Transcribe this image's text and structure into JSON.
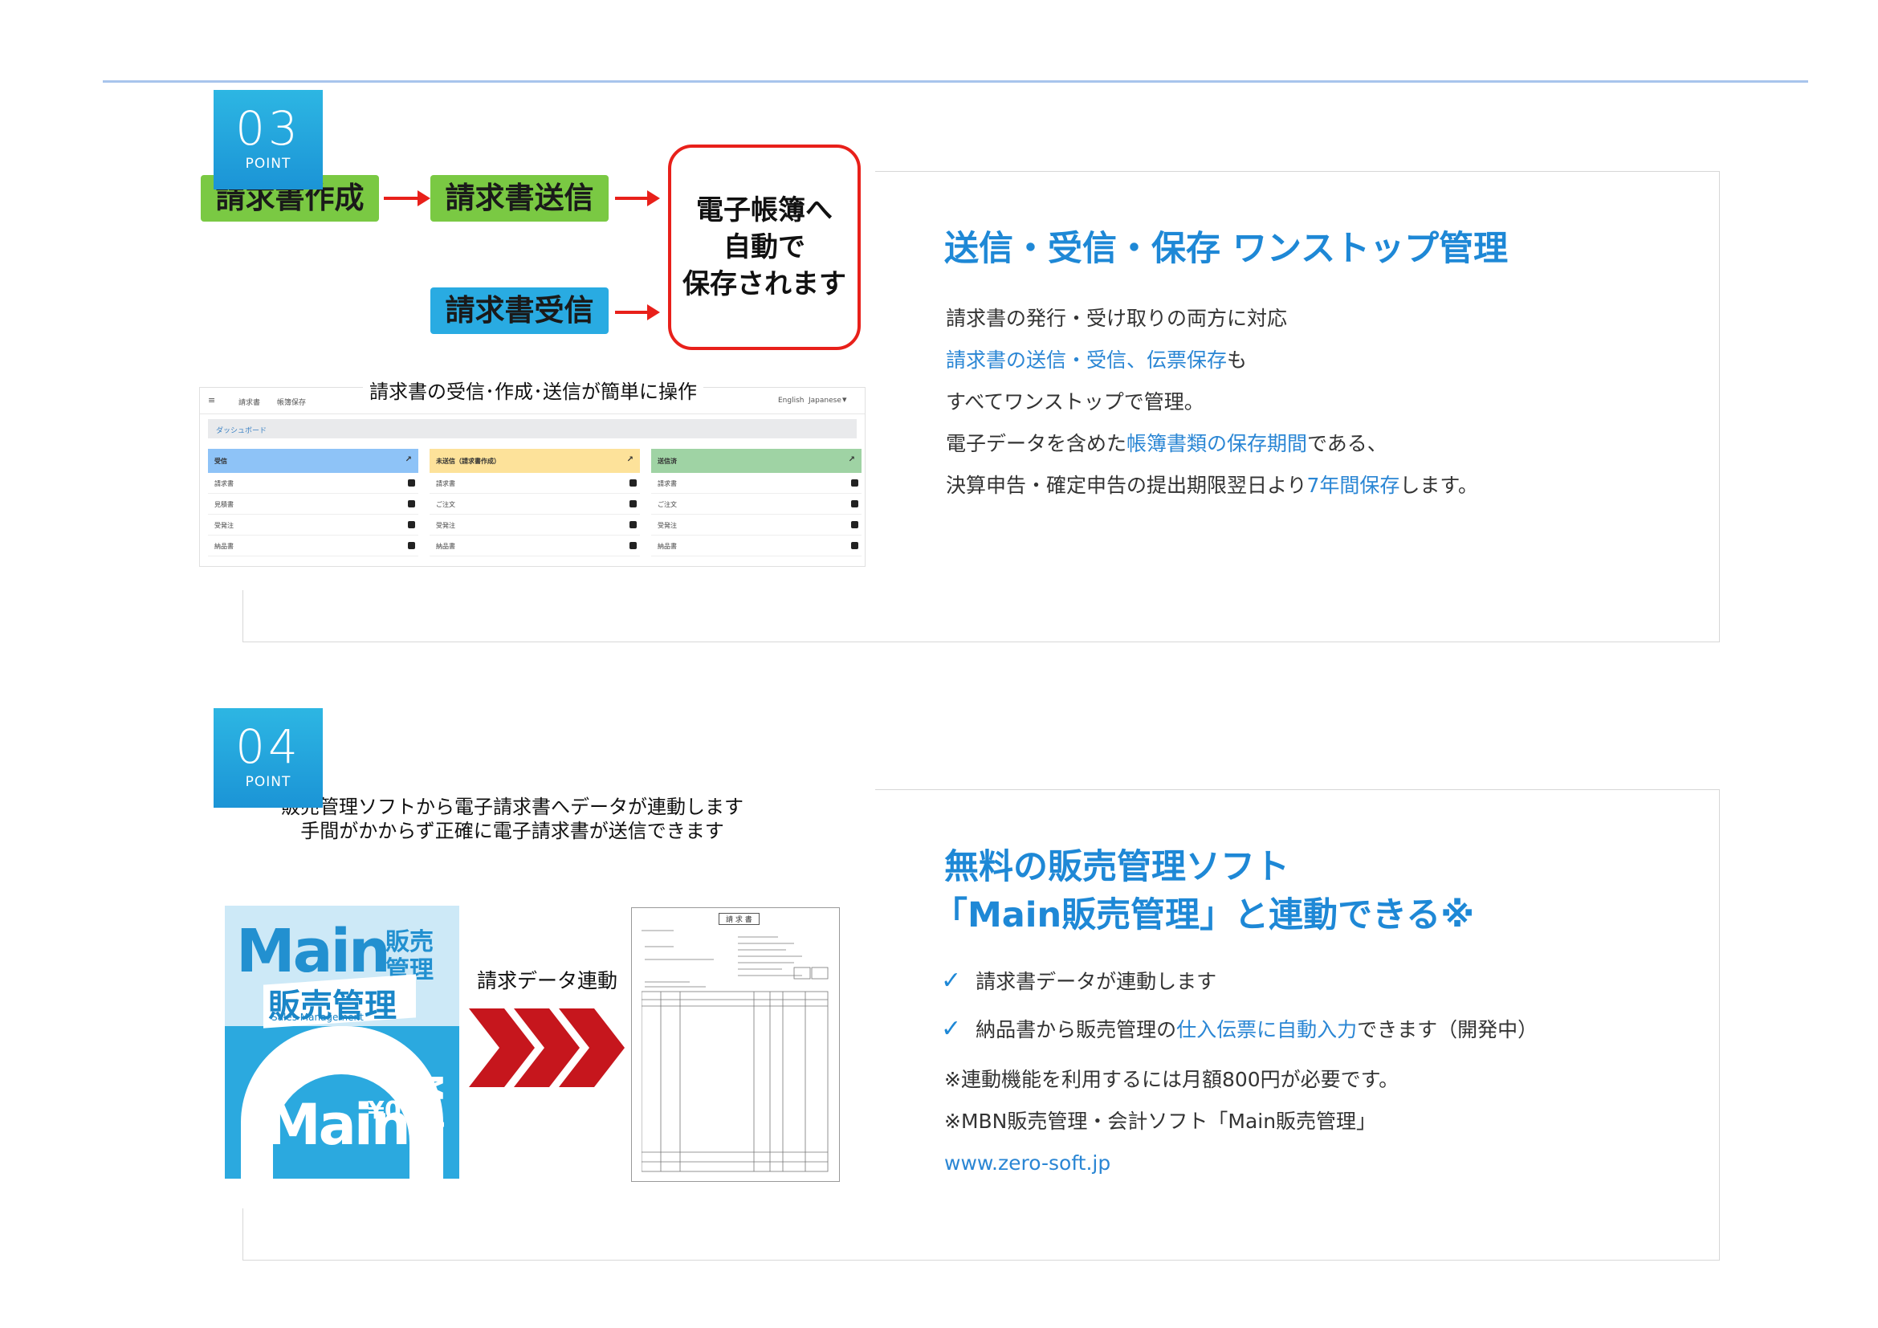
{
  "section3": {
    "badge_num": "03",
    "badge_label": "POINT",
    "flow": {
      "create": "請求書作成",
      "send": "請求書送信",
      "receive": "請求書受信",
      "save_line1": "電子帳簿へ",
      "save_line2": "自動で",
      "save_line3": "保存されます"
    },
    "screenshot_caption": "請求書の受信･作成･送信が簡単に操作",
    "dashboard": {
      "nav_items": [
        "請求書",
        "帳簿保存"
      ],
      "lang_en": "English",
      "lang_ja": "Japanese",
      "breadcrumb": "ダッシュボード",
      "columns": [
        {
          "title": "受信",
          "color": "#8ec3f7",
          "rows": [
            "請求書",
            "見積書",
            "受発注",
            "納品書"
          ]
        },
        {
          "title": "未送信（請求書作成）",
          "color": "#fde29a",
          "rows": [
            "請求書",
            "ご注文",
            "受発注",
            "納品書"
          ]
        },
        {
          "title": "送信済",
          "color": "#9fd3a4",
          "rows": [
            "請求書",
            "ご注文",
            "受発注",
            "納品書"
          ]
        }
      ]
    },
    "heading": "送信・受信・保存 ワンストップ管理",
    "lines": [
      {
        "parts": [
          {
            "t": "請求書の発行・受け取りの両方に対応",
            "h": false
          }
        ]
      },
      {
        "parts": [
          {
            "t": "請求書の送信・受信、伝票保存",
            "h": true
          },
          {
            "t": "も",
            "h": false
          }
        ]
      },
      {
        "parts": [
          {
            "t": "すべてワンストップで管理。",
            "h": false
          }
        ]
      },
      {
        "parts": [
          {
            "t": "電子データを含めた",
            "h": false
          },
          {
            "t": "帳簿書類の保存期間",
            "h": true
          },
          {
            "t": "である、",
            "h": false
          }
        ]
      },
      {
        "parts": [
          {
            "t": "決算申告・確定申告の提出期限翌日より",
            "h": false
          },
          {
            "t": "7年間保存",
            "h": true
          },
          {
            "t": "します。",
            "h": false
          }
        ]
      }
    ]
  },
  "section4": {
    "badge_num": "04",
    "badge_label": "POINT",
    "intro_line1": "販売管理ソフトから電子請求書へデータが連動します",
    "intro_line2": "手間がかからず正確に電子請求書が送信できます",
    "box": {
      "logo_top": "Main",
      "logo_side1": "販売",
      "logo_side2": "管理",
      "band": "販売管理",
      "band_sub": "Sales Management",
      "logo_bottom": "Main",
      "yen": "¥0",
      "spine": "Main"
    },
    "link_label": "請求データ連動",
    "invoice_title": "請 求 書",
    "heading_line1": "無料の販売管理ソフト",
    "heading_line2": "「Main販売管理」と連動できる※",
    "checks": [
      {
        "parts": [
          {
            "t": "請求書データが連動します",
            "h": false
          }
        ]
      },
      {
        "parts": [
          {
            "t": "納品書から販売管理の",
            "h": false
          },
          {
            "t": "仕入伝票に自動入力",
            "h": true
          },
          {
            "t": "できます（開発中）",
            "h": false
          }
        ]
      }
    ],
    "note1": "※連動機能を利用するには月額800円が必要です。",
    "note2": "※MBN販売管理・会計ソフト「Main販売管理」",
    "url": "www.zero-soft.jp"
  }
}
